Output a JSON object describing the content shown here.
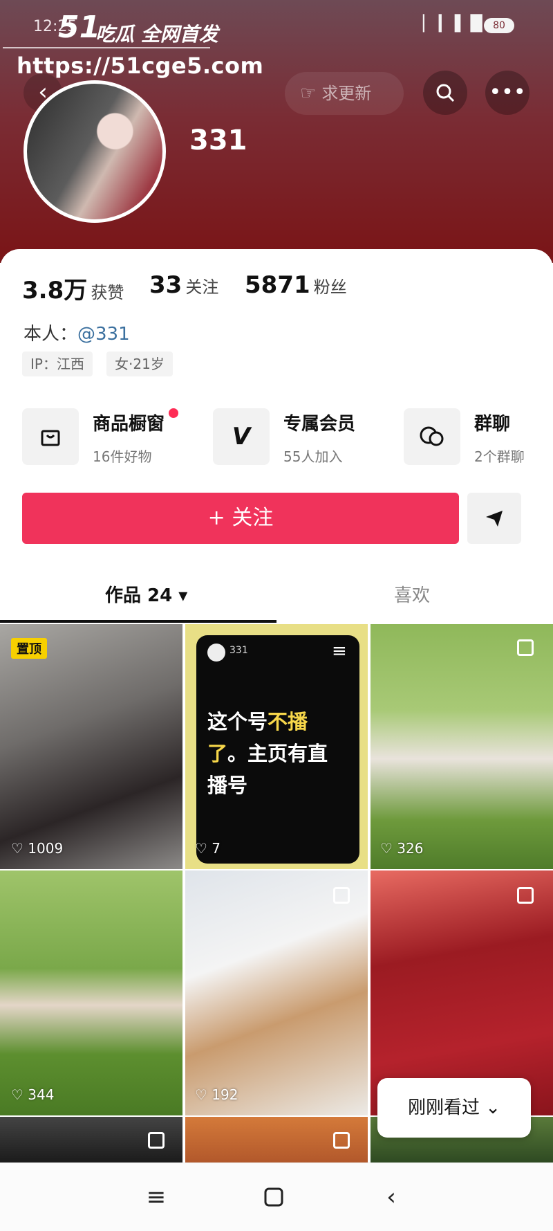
{
  "status_bar": {
    "time": "12:25",
    "signal_icons": "▏▎▌█",
    "battery": "80"
  },
  "watermark": {
    "logo": "51",
    "text": "吃瓜 全网首发",
    "url": "https://51cge5.com"
  },
  "header": {
    "back_icon": "chevron-left-icon",
    "search_pill_label": "求更新",
    "nickname": "331"
  },
  "stats": [
    {
      "value": "3.8万",
      "label": "获赞"
    },
    {
      "value": "33",
      "label": "关注"
    },
    {
      "value": "5871",
      "label": "粉丝"
    }
  ],
  "intro": {
    "prefix": "本人：",
    "handle": "@331"
  },
  "tags": [
    "IP：江西",
    "女·21岁"
  ],
  "features": [
    {
      "title": "商品橱窗",
      "subtitle": "16件好物",
      "icon": "bag-icon"
    },
    {
      "title": "专属会员",
      "subtitle": "55人加入",
      "icon": "v-icon"
    },
    {
      "title": "群聊",
      "subtitle": "2个群聊",
      "icon": "chat-icon"
    }
  ],
  "actions": {
    "follow_label": "+ 关注",
    "share_icon": "send-icon"
  },
  "tabs": [
    {
      "label": "作品 24 ▾"
    },
    {
      "label": "喜欢"
    }
  ],
  "grid": [
    {
      "likes": "1009",
      "pinned": "置顶"
    },
    {
      "likes": "7"
    },
    {
      "likes": "326"
    },
    {
      "likes": "344"
    },
    {
      "likes": "192"
    },
    {
      "likes": ""
    }
  ],
  "notice": {
    "header_label": "331",
    "line1_a": "这个号",
    "line1_b": "不播",
    "line2_a": "了",
    "line2_b": "。主页有直",
    "line3": "播号"
  },
  "recent_button": {
    "label": "刚刚看过 ⌄"
  },
  "colors": {
    "brand": "#f0335b",
    "header_top": "#6e4a55",
    "header_bottom": "#7a1416",
    "highlight": "#f7d74a"
  }
}
